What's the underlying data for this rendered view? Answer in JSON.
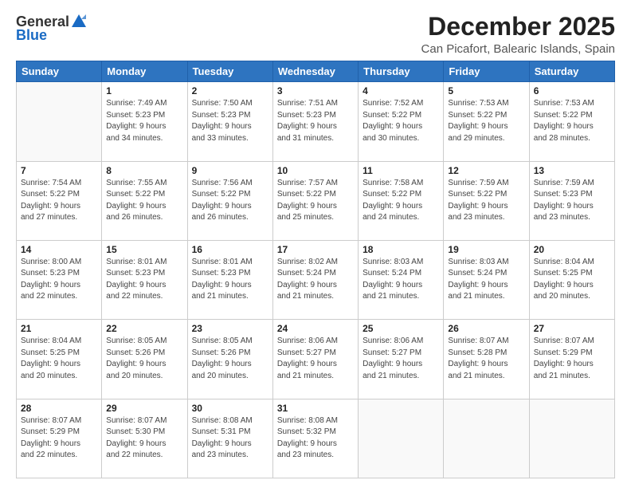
{
  "header": {
    "logo_general": "General",
    "logo_blue": "Blue",
    "title": "December 2025",
    "subtitle": "Can Picafort, Balearic Islands, Spain"
  },
  "days_of_week": [
    "Sunday",
    "Monday",
    "Tuesday",
    "Wednesday",
    "Thursday",
    "Friday",
    "Saturday"
  ],
  "weeks": [
    [
      {
        "day": "",
        "info": ""
      },
      {
        "day": "1",
        "info": "Sunrise: 7:49 AM\nSunset: 5:23 PM\nDaylight: 9 hours\nand 34 minutes."
      },
      {
        "day": "2",
        "info": "Sunrise: 7:50 AM\nSunset: 5:23 PM\nDaylight: 9 hours\nand 33 minutes."
      },
      {
        "day": "3",
        "info": "Sunrise: 7:51 AM\nSunset: 5:23 PM\nDaylight: 9 hours\nand 31 minutes."
      },
      {
        "day": "4",
        "info": "Sunrise: 7:52 AM\nSunset: 5:22 PM\nDaylight: 9 hours\nand 30 minutes."
      },
      {
        "day": "5",
        "info": "Sunrise: 7:53 AM\nSunset: 5:22 PM\nDaylight: 9 hours\nand 29 minutes."
      },
      {
        "day": "6",
        "info": "Sunrise: 7:53 AM\nSunset: 5:22 PM\nDaylight: 9 hours\nand 28 minutes."
      }
    ],
    [
      {
        "day": "7",
        "info": "Sunrise: 7:54 AM\nSunset: 5:22 PM\nDaylight: 9 hours\nand 27 minutes."
      },
      {
        "day": "8",
        "info": "Sunrise: 7:55 AM\nSunset: 5:22 PM\nDaylight: 9 hours\nand 26 minutes."
      },
      {
        "day": "9",
        "info": "Sunrise: 7:56 AM\nSunset: 5:22 PM\nDaylight: 9 hours\nand 26 minutes."
      },
      {
        "day": "10",
        "info": "Sunrise: 7:57 AM\nSunset: 5:22 PM\nDaylight: 9 hours\nand 25 minutes."
      },
      {
        "day": "11",
        "info": "Sunrise: 7:58 AM\nSunset: 5:22 PM\nDaylight: 9 hours\nand 24 minutes."
      },
      {
        "day": "12",
        "info": "Sunrise: 7:59 AM\nSunset: 5:22 PM\nDaylight: 9 hours\nand 23 minutes."
      },
      {
        "day": "13",
        "info": "Sunrise: 7:59 AM\nSunset: 5:23 PM\nDaylight: 9 hours\nand 23 minutes."
      }
    ],
    [
      {
        "day": "14",
        "info": "Sunrise: 8:00 AM\nSunset: 5:23 PM\nDaylight: 9 hours\nand 22 minutes."
      },
      {
        "day": "15",
        "info": "Sunrise: 8:01 AM\nSunset: 5:23 PM\nDaylight: 9 hours\nand 22 minutes."
      },
      {
        "day": "16",
        "info": "Sunrise: 8:01 AM\nSunset: 5:23 PM\nDaylight: 9 hours\nand 21 minutes."
      },
      {
        "day": "17",
        "info": "Sunrise: 8:02 AM\nSunset: 5:24 PM\nDaylight: 9 hours\nand 21 minutes."
      },
      {
        "day": "18",
        "info": "Sunrise: 8:03 AM\nSunset: 5:24 PM\nDaylight: 9 hours\nand 21 minutes."
      },
      {
        "day": "19",
        "info": "Sunrise: 8:03 AM\nSunset: 5:24 PM\nDaylight: 9 hours\nand 21 minutes."
      },
      {
        "day": "20",
        "info": "Sunrise: 8:04 AM\nSunset: 5:25 PM\nDaylight: 9 hours\nand 20 minutes."
      }
    ],
    [
      {
        "day": "21",
        "info": "Sunrise: 8:04 AM\nSunset: 5:25 PM\nDaylight: 9 hours\nand 20 minutes."
      },
      {
        "day": "22",
        "info": "Sunrise: 8:05 AM\nSunset: 5:26 PM\nDaylight: 9 hours\nand 20 minutes."
      },
      {
        "day": "23",
        "info": "Sunrise: 8:05 AM\nSunset: 5:26 PM\nDaylight: 9 hours\nand 20 minutes."
      },
      {
        "day": "24",
        "info": "Sunrise: 8:06 AM\nSunset: 5:27 PM\nDaylight: 9 hours\nand 21 minutes."
      },
      {
        "day": "25",
        "info": "Sunrise: 8:06 AM\nSunset: 5:27 PM\nDaylight: 9 hours\nand 21 minutes."
      },
      {
        "day": "26",
        "info": "Sunrise: 8:07 AM\nSunset: 5:28 PM\nDaylight: 9 hours\nand 21 minutes."
      },
      {
        "day": "27",
        "info": "Sunrise: 8:07 AM\nSunset: 5:29 PM\nDaylight: 9 hours\nand 21 minutes."
      }
    ],
    [
      {
        "day": "28",
        "info": "Sunrise: 8:07 AM\nSunset: 5:29 PM\nDaylight: 9 hours\nand 22 minutes."
      },
      {
        "day": "29",
        "info": "Sunrise: 8:07 AM\nSunset: 5:30 PM\nDaylight: 9 hours\nand 22 minutes."
      },
      {
        "day": "30",
        "info": "Sunrise: 8:08 AM\nSunset: 5:31 PM\nDaylight: 9 hours\nand 23 minutes."
      },
      {
        "day": "31",
        "info": "Sunrise: 8:08 AM\nSunset: 5:32 PM\nDaylight: 9 hours\nand 23 minutes."
      },
      {
        "day": "",
        "info": ""
      },
      {
        "day": "",
        "info": ""
      },
      {
        "day": "",
        "info": ""
      }
    ]
  ]
}
